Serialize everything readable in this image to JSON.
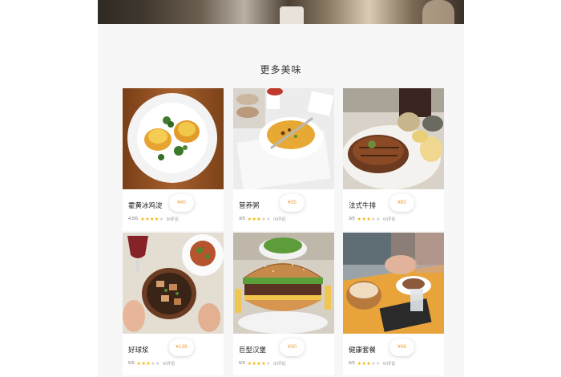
{
  "section": {
    "title": "更多美味"
  },
  "dishes": [
    {
      "name": "霍黄冰鸡淀",
      "price": "¥40",
      "rating": "4.5/5",
      "stars": 4,
      "reviews": "9/评论"
    },
    {
      "name": "营养粥",
      "price": "¥35",
      "rating": "3/5",
      "stars": 3,
      "reviews": "0/评论"
    },
    {
      "name": "法式牛排",
      "price": "¥85",
      "rating": "3/5",
      "stars": 3,
      "reviews": "0/评论"
    },
    {
      "name": "好球浆",
      "price": "¥138",
      "rating": "5/5",
      "stars": 3,
      "reviews": "0/评论"
    },
    {
      "name": "巨型汉堡",
      "price": "¥30",
      "rating": "5/5",
      "stars": 4,
      "reviews": "0/评论"
    },
    {
      "name": "健康套餐",
      "price": "¥48",
      "rating": "5/5",
      "stars": 3,
      "reviews": "0/评论"
    }
  ],
  "colors": {
    "accent": "#f0a23a",
    "star": "#f5b301",
    "panel": "#f7f7f7"
  }
}
